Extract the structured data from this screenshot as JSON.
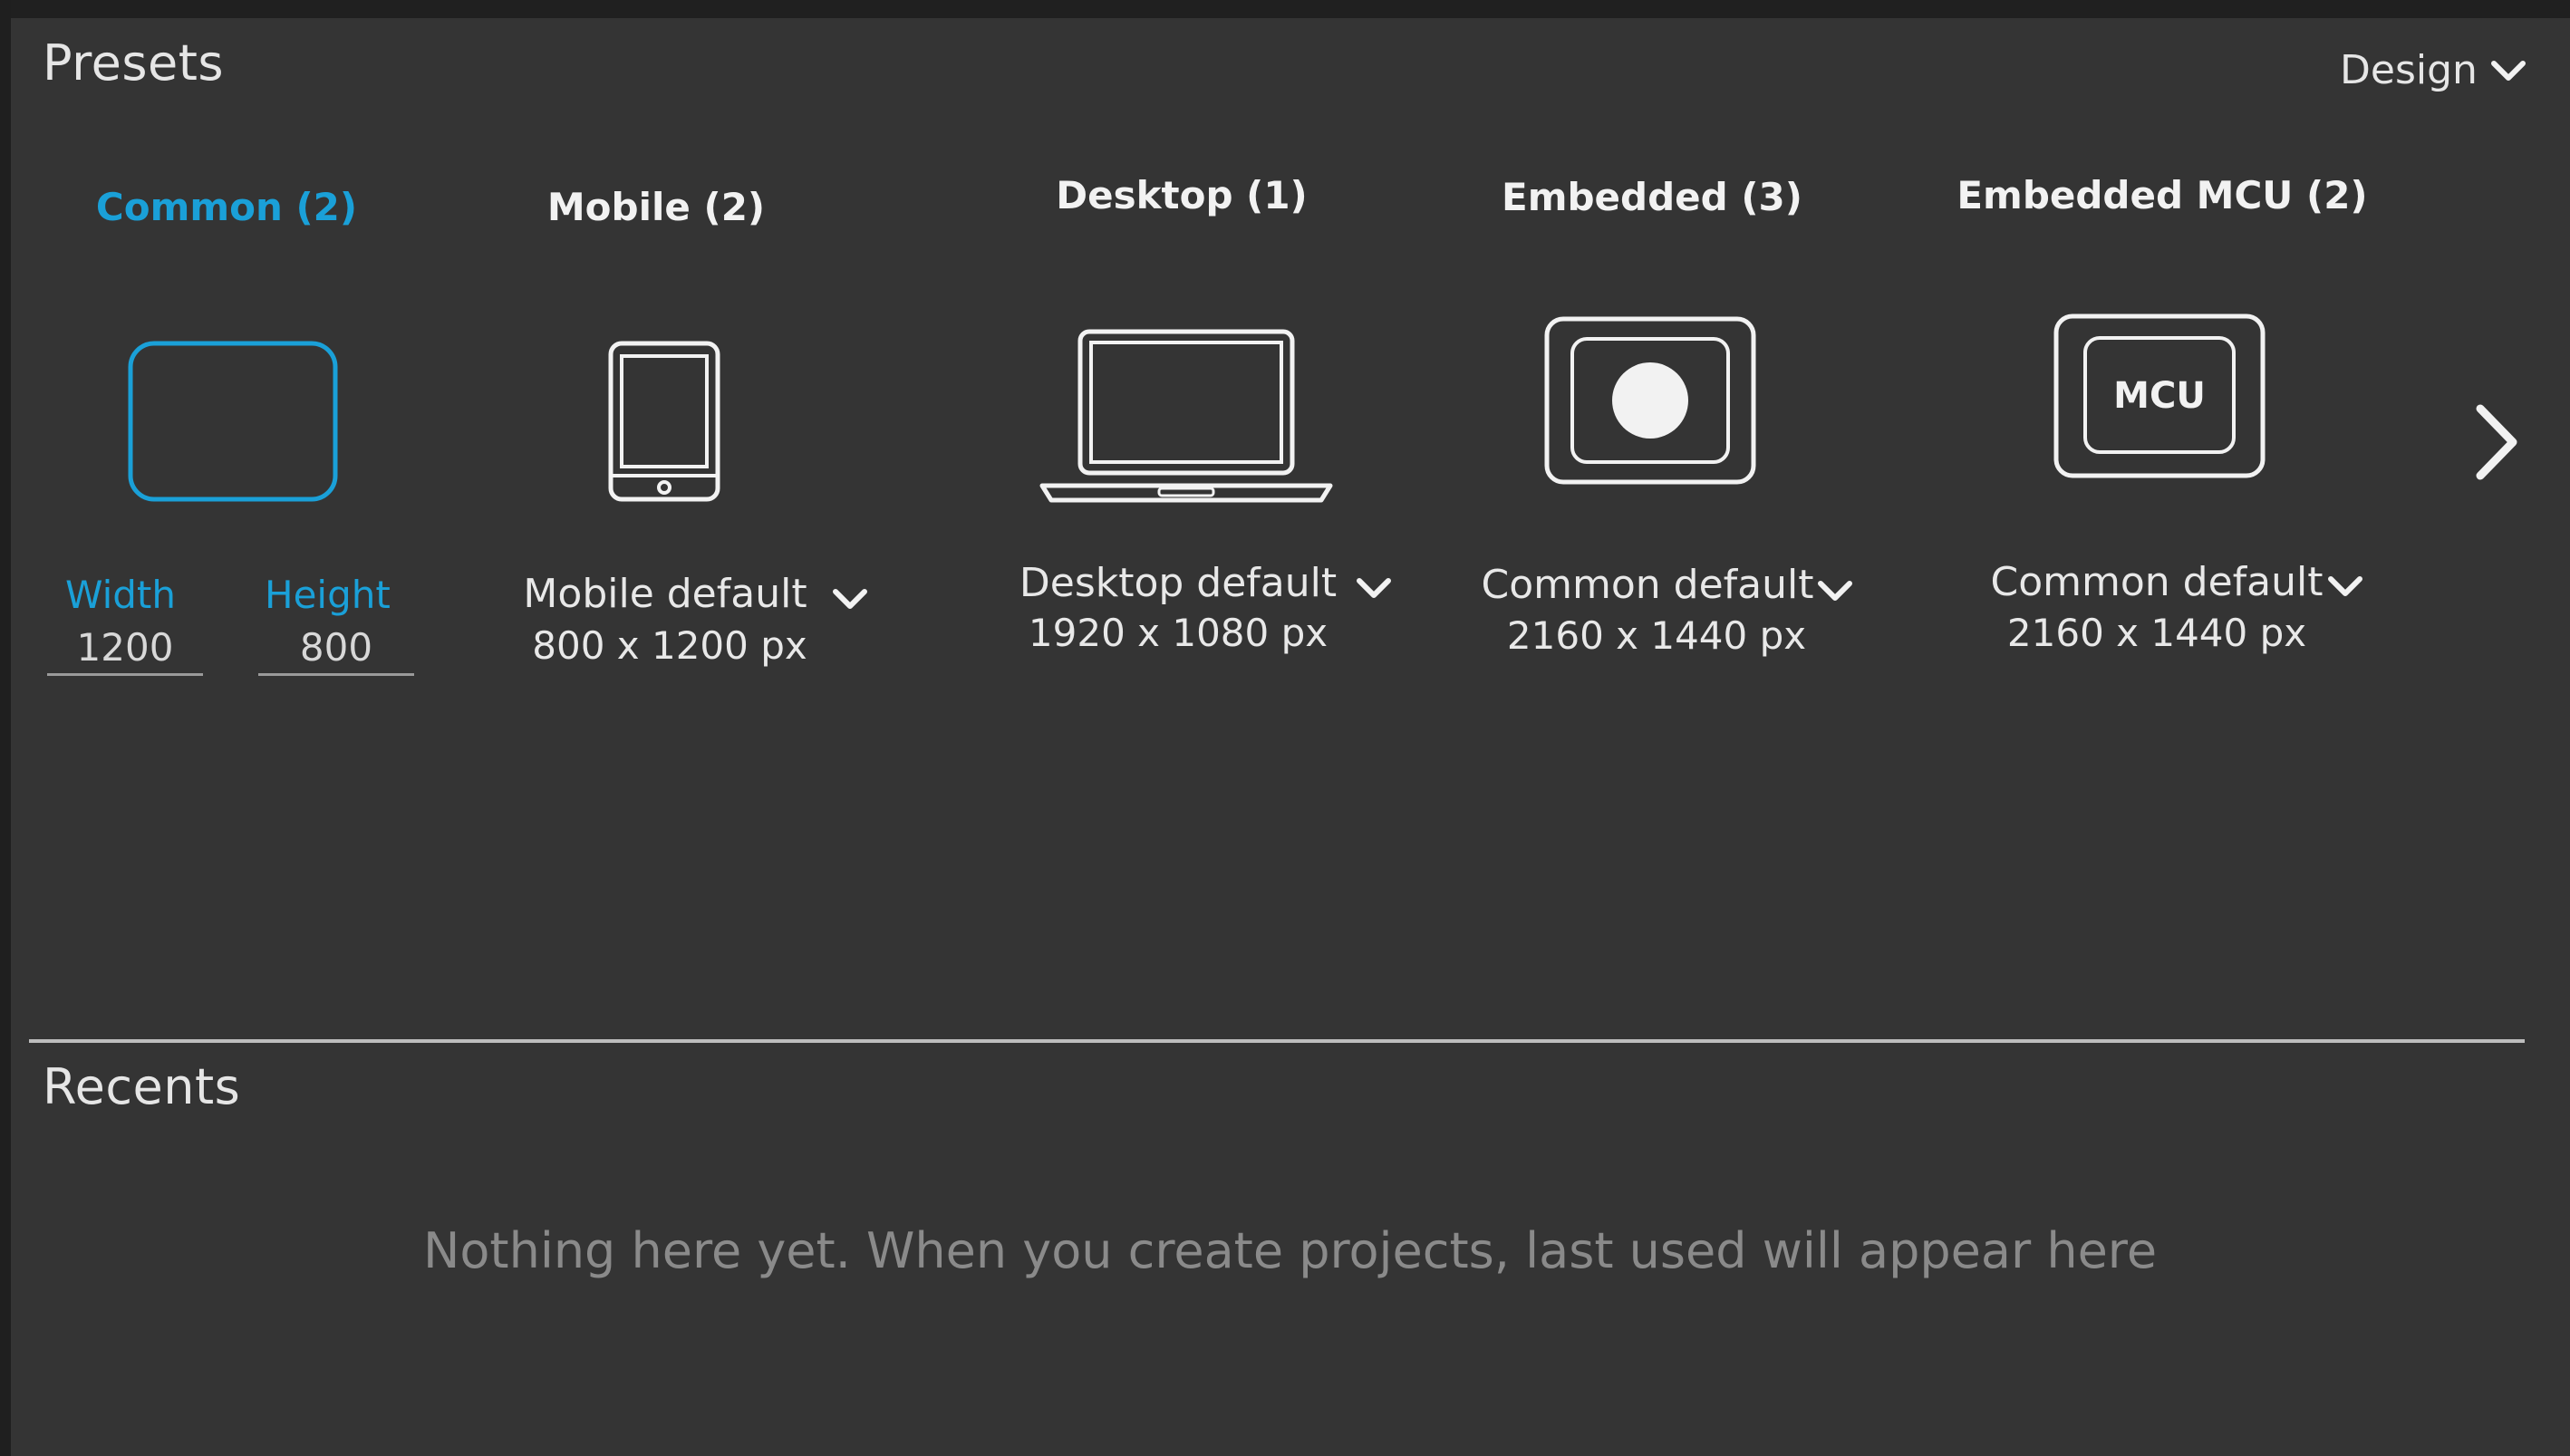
{
  "header": {
    "title": "Presets",
    "design_menu_label": "Design"
  },
  "categories": [
    {
      "label": "Common (2)",
      "active": true,
      "icon": "rounded-rectangle-icon"
    },
    {
      "label": "Mobile (2)",
      "active": false,
      "icon": "phone-icon"
    },
    {
      "label": "Desktop (1)",
      "active": false,
      "icon": "laptop-icon"
    },
    {
      "label": "Embedded (3)",
      "active": false,
      "icon": "embedded-device-icon"
    },
    {
      "label": "Embedded MCU (2)",
      "active": false,
      "icon": "mcu-chip-icon",
      "icon_text": "MCU"
    }
  ],
  "common": {
    "width_label": "Width",
    "height_label": "Height",
    "width_value": "1200",
    "height_value": "800"
  },
  "presets": [
    {
      "name": "Mobile default",
      "size": "800 x 1200 px"
    },
    {
      "name": "Desktop  default",
      "size": "1920 x 1080 px"
    },
    {
      "name": "Common  default",
      "size": "2160 x 1440 px"
    },
    {
      "name": "Common  default",
      "size": "2160 x 1440 px"
    }
  ],
  "recents": {
    "title": "Recents",
    "empty_message": "Nothing here yet. When you  create projects, last used will appear here"
  },
  "colors": {
    "background": "#343434",
    "accent": "#1aa0d8",
    "text": "#f2f2f2",
    "muted_text": "#8a8a8a"
  }
}
